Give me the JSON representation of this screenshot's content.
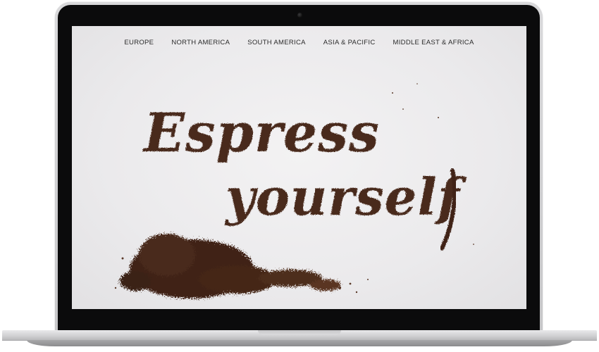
{
  "nav": {
    "items": [
      "EUROPE",
      "NORTH AMERICA",
      "SOUTH AMERICA",
      "ASIA & PACIFIC",
      "MIDDLE EAST & AFRICA"
    ]
  },
  "hero": {
    "line1": "Espress",
    "line2": "yourself"
  },
  "colors": {
    "coffee": "#4a2b1d",
    "coffee_dark": "#3a2016",
    "screen_bg": "#eceaec",
    "nav_text": "#2a2a2a"
  }
}
